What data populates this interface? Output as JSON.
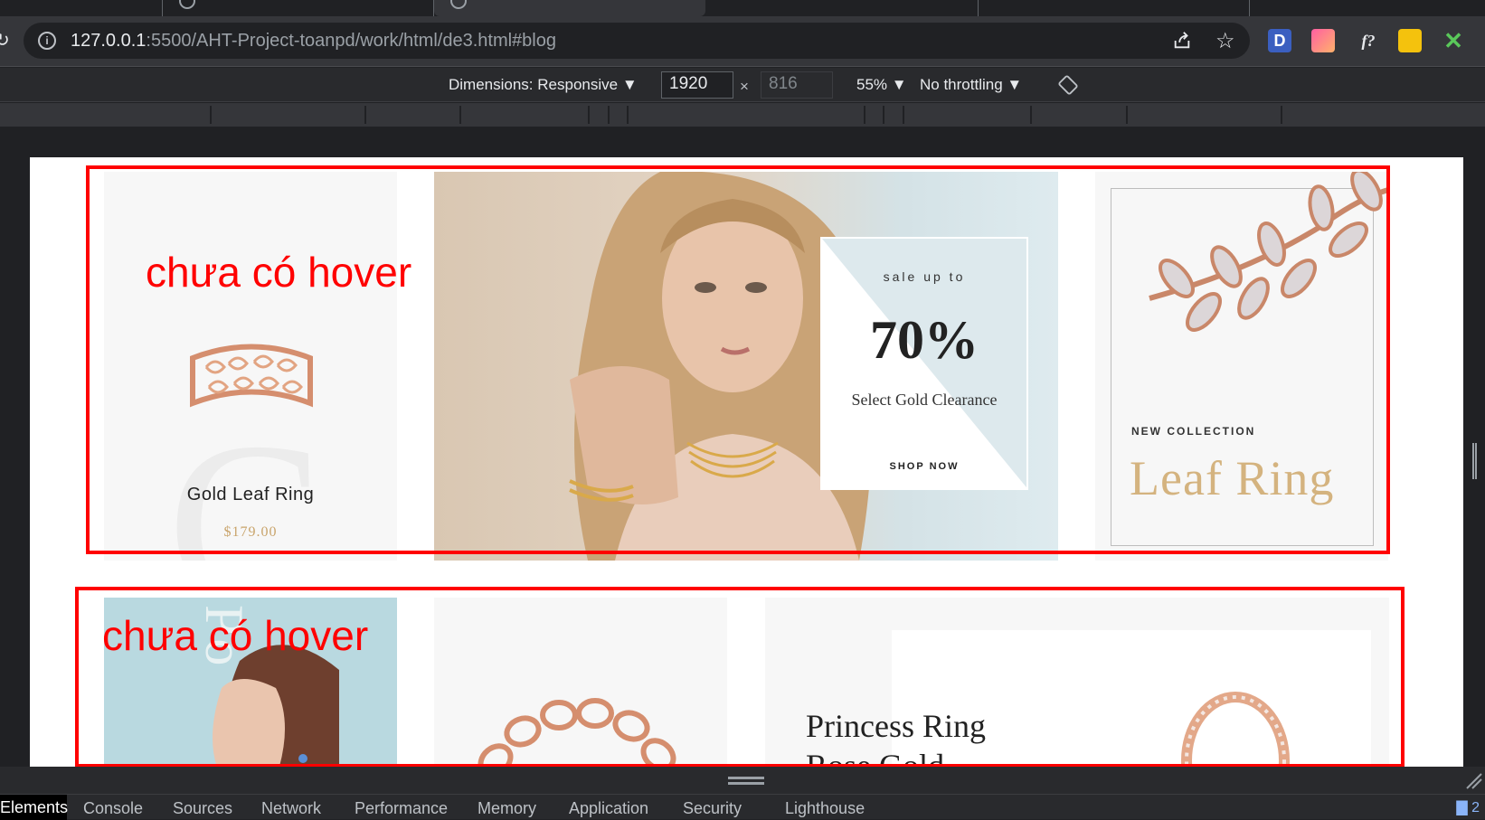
{
  "browser": {
    "url_host": "127.0.0.1",
    "url_path": ":5500/AHT-Project-toanpd/work/html/de3.html#blog",
    "ext_d": "D",
    "ext_f": "f?"
  },
  "device_toolbar": {
    "dimensions_label": "Dimensions: Responsive",
    "width": "1920",
    "times": "×",
    "height": "816",
    "zoom": "55%",
    "throttling": "No throttling",
    "caret": "▼"
  },
  "page": {
    "gold_leaf": {
      "title": "Gold Leaf Ring",
      "price": "$179.00"
    },
    "sale": {
      "top": "sale up to",
      "percent": "70%",
      "subtitle": "Select Gold Clearance",
      "cta": "SHOP NOW"
    },
    "leaf_ring": {
      "eyebrow": "NEW COLLECTION",
      "title": "Leaf  Ring"
    },
    "princess": {
      "line1": "Princess Ring",
      "line2": "Rose Gold"
    }
  },
  "annotations": [
    {
      "text": "chưa có hover"
    },
    {
      "text": "chưa có hover"
    }
  ],
  "devtools": {
    "tabs": [
      "Elements",
      "Console",
      "Sources",
      "Network",
      "Performance",
      "Memory",
      "Application",
      "Security",
      "Lighthouse"
    ],
    "issues_count": "2"
  },
  "colors": {
    "annotation": "#ff0000",
    "gold": "#c9a46b",
    "chrome_bg": "#202124"
  }
}
